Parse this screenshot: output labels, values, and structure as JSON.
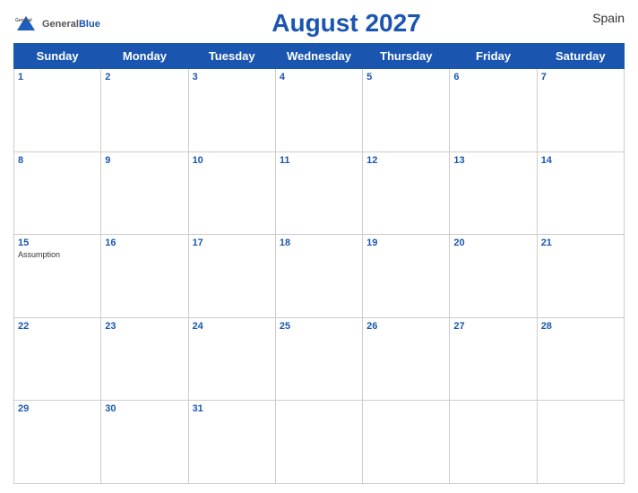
{
  "header": {
    "logo_general": "General",
    "logo_blue": "Blue",
    "title": "August 2027",
    "country": "Spain"
  },
  "weekdays": [
    "Sunday",
    "Monday",
    "Tuesday",
    "Wednesday",
    "Thursday",
    "Friday",
    "Saturday"
  ],
  "weeks": [
    [
      {
        "day": "1",
        "event": ""
      },
      {
        "day": "2",
        "event": ""
      },
      {
        "day": "3",
        "event": ""
      },
      {
        "day": "4",
        "event": ""
      },
      {
        "day": "5",
        "event": ""
      },
      {
        "day": "6",
        "event": ""
      },
      {
        "day": "7",
        "event": ""
      }
    ],
    [
      {
        "day": "8",
        "event": ""
      },
      {
        "day": "9",
        "event": ""
      },
      {
        "day": "10",
        "event": ""
      },
      {
        "day": "11",
        "event": ""
      },
      {
        "day": "12",
        "event": ""
      },
      {
        "day": "13",
        "event": ""
      },
      {
        "day": "14",
        "event": ""
      }
    ],
    [
      {
        "day": "15",
        "event": "Assumption"
      },
      {
        "day": "16",
        "event": ""
      },
      {
        "day": "17",
        "event": ""
      },
      {
        "day": "18",
        "event": ""
      },
      {
        "day": "19",
        "event": ""
      },
      {
        "day": "20",
        "event": ""
      },
      {
        "day": "21",
        "event": ""
      }
    ],
    [
      {
        "day": "22",
        "event": ""
      },
      {
        "day": "23",
        "event": ""
      },
      {
        "day": "24",
        "event": ""
      },
      {
        "day": "25",
        "event": ""
      },
      {
        "day": "26",
        "event": ""
      },
      {
        "day": "27",
        "event": ""
      },
      {
        "day": "28",
        "event": ""
      }
    ],
    [
      {
        "day": "29",
        "event": ""
      },
      {
        "day": "30",
        "event": ""
      },
      {
        "day": "31",
        "event": ""
      },
      {
        "day": "",
        "event": ""
      },
      {
        "day": "",
        "event": ""
      },
      {
        "day": "",
        "event": ""
      },
      {
        "day": "",
        "event": ""
      }
    ]
  ]
}
